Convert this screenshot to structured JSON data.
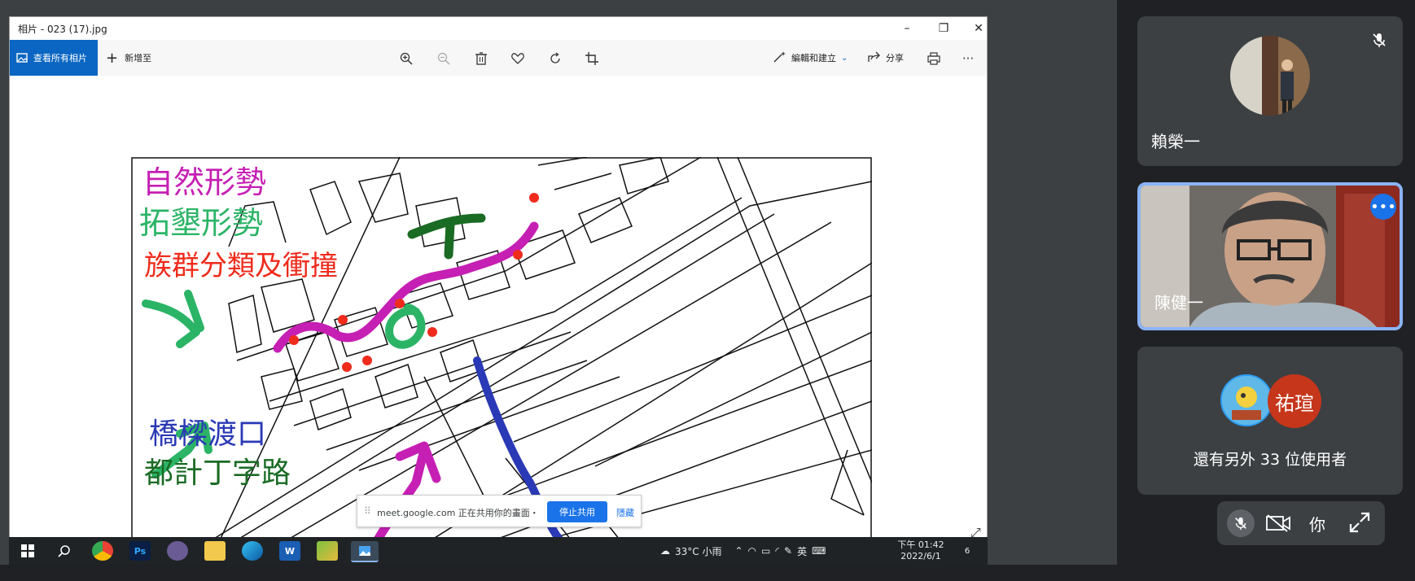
{
  "photos_window": {
    "title": "相片 - 023 (17).jpg",
    "controls": {
      "minimize": "–",
      "restore": "❐",
      "close": "✕"
    },
    "toolbar": {
      "view_all": "查看所有相片",
      "add_to": "新增至",
      "edit_create": "編輯和建立",
      "share": "分享",
      "more": "···"
    }
  },
  "map_labels": {
    "natural": "自然形勢",
    "reclaim": "拓墾形勢",
    "ethnic": "族群分類及衝撞",
    "bridge": "橋樑渡口",
    "urban": "都計丁字路"
  },
  "share_banner": {
    "message": "meet.google.com 正在共用你的畫面・",
    "stop": "停止共用",
    "hide": "隱藏"
  },
  "taskbar": {
    "weather": "33°C  小雨",
    "ime": "英",
    "time": "下午 01:42",
    "date": "2022/6/1",
    "notif_count": "6",
    "apps": [
      "Ps",
      "W"
    ]
  },
  "participants": {
    "p1_name": "賴榮一",
    "p2_name": "陳健一",
    "p3_avatar_text": "祐瑄",
    "others": "還有另外 33 位使用者"
  },
  "meet_controls": {
    "you": "你"
  },
  "colors": {
    "accent_blue": "#1a73e8",
    "highlight": "#8ab4f8",
    "tile_bg": "#3c4043",
    "avatar_orange": "#c5361b",
    "pen_magenta": "#c61fb4",
    "pen_green": "#2bb466",
    "pen_red": "#ef2b1c",
    "pen_blue": "#2a39b5",
    "pen_darkgreen": "#1a6b24"
  }
}
